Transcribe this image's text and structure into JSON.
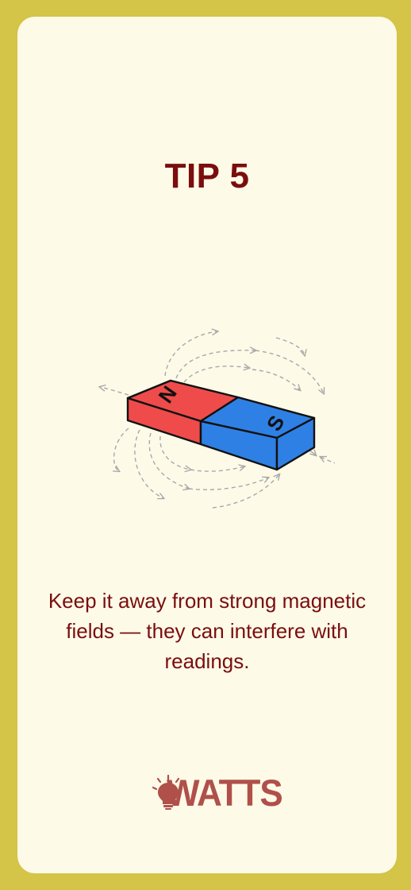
{
  "tip": {
    "title": "TIP 5",
    "body": "Keep it away from strong magnetic fields — they can interfere with readings."
  },
  "magnet": {
    "north_label": "N",
    "south_label": "S",
    "north_color": "#ef4b4b",
    "south_color": "#2f80e4"
  },
  "brand": {
    "name": "WATTS",
    "icon": "lightbulb-icon",
    "color": "#b0504a"
  },
  "colors": {
    "frame": "#d4c447",
    "card": "#fdfae8",
    "text": "#7a0e0e"
  }
}
